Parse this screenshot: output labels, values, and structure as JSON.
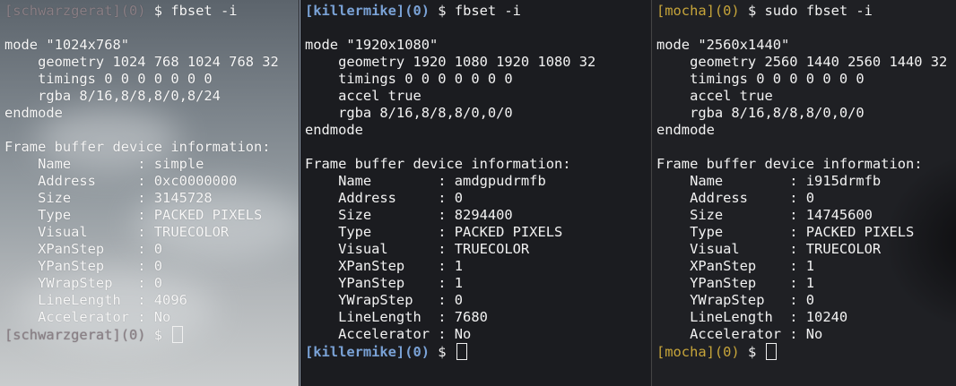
{
  "panes": [
    {
      "prompt": "[schwarzgerat](0)",
      "command": "fbset -i",
      "output": [
        "",
        "mode \"1024x768\"",
        "    geometry 1024 768 1024 768 32",
        "    timings 0 0 0 0 0 0 0",
        "    rgba 8/16,8/8,8/0,8/24",
        "endmode",
        "",
        "Frame buffer device information:",
        "    Name        : simple",
        "    Address     : 0xc0000000",
        "    Size        : 3145728",
        "    Type        : PACKED PIXELS",
        "    Visual      : TRUECOLOR",
        "    XPanStep    : 0",
        "    YPanStep    : 0",
        "    YWrapStep   : 0",
        "    LineLength  : 4096",
        "    Accelerator : No"
      ],
      "final_prompt": "[schwarzgerat](0)"
    },
    {
      "prompt": "[killermike](0)",
      "command": "fbset -i",
      "output": [
        "",
        "mode \"1920x1080\"",
        "    geometry 1920 1080 1920 1080 32",
        "    timings 0 0 0 0 0 0 0",
        "    accel true",
        "    rgba 8/16,8/8,8/0,0/0",
        "endmode",
        "",
        "Frame buffer device information:",
        "    Name        : amdgpudrmfb",
        "    Address     : 0",
        "    Size        : 8294400",
        "    Type        : PACKED PIXELS",
        "    Visual      : TRUECOLOR",
        "    XPanStep    : 1",
        "    YPanStep    : 1",
        "    YWrapStep   : 0",
        "    LineLength  : 7680",
        "    Accelerator : No"
      ],
      "final_prompt": "[killermike](0)"
    },
    {
      "prompt": "[mocha](0)",
      "command": "sudo fbset -i",
      "output": [
        "",
        "mode \"2560x1440\"",
        "    geometry 2560 1440 2560 1440 32",
        "    timings 0 0 0 0 0 0 0",
        "    accel true",
        "    rgba 8/16,8/8,8/0,0/0",
        "endmode",
        "",
        "Frame buffer device information:",
        "    Name        : i915drmfb",
        "    Address     : 0",
        "    Size        : 14745600",
        "    Type        : PACKED PIXELS",
        "    Visual      : TRUECOLOR",
        "    XPanStep    : 1",
        "    YPanStep    : 1",
        "    YWrapStep   : 0",
        "    LineLength  : 10240",
        "    Accelerator : No"
      ],
      "final_prompt": "[mocha](0)"
    }
  ],
  "prompt_suffix": " $ ",
  "colors": {
    "prompt_schwarzgerat": "#8a7f85",
    "prompt_killermike": "#7aa2d6",
    "prompt_mocha": "#c7a53a",
    "text": "#f2f2f2"
  }
}
